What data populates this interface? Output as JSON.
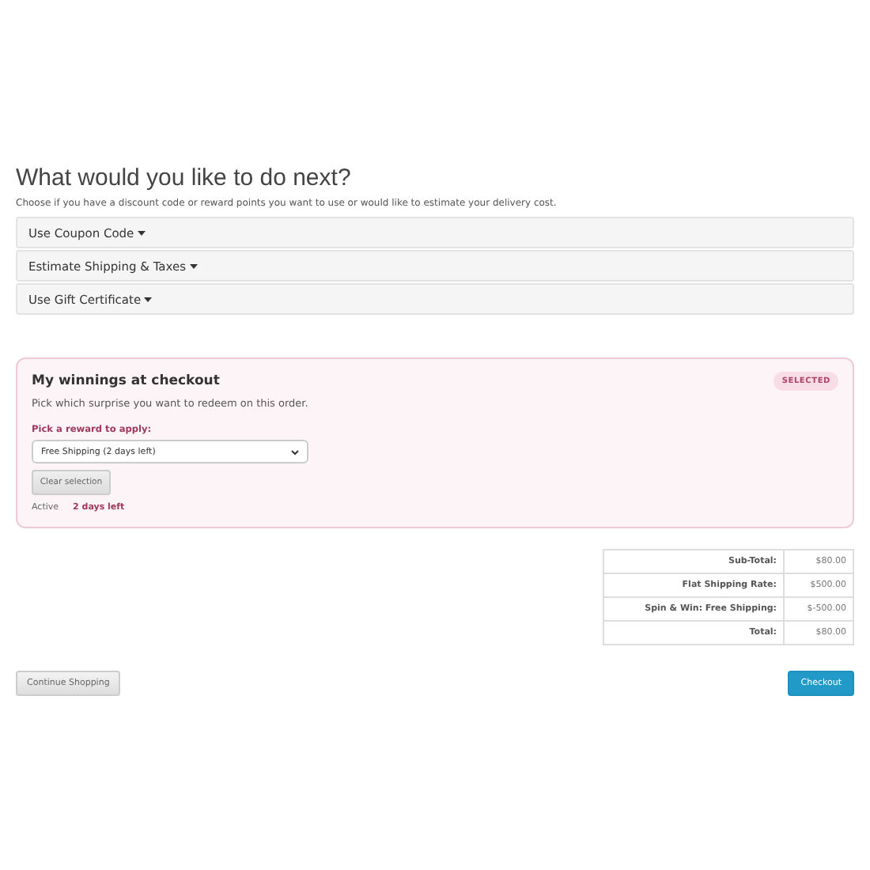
{
  "heading": "What would you like to do next?",
  "intro": "Choose if you have a discount code or reward points you want to use or would like to estimate your delivery cost.",
  "panels": [
    {
      "title": "Use Coupon Code",
      "expanded": false
    },
    {
      "title": "Estimate Shipping & Taxes",
      "expanded": false
    },
    {
      "title": "Use Gift Certificate",
      "expanded": false
    }
  ],
  "rewards": {
    "title": "My winnings at checkout",
    "badge": "SELECTED",
    "description": "Pick which surprise you want to redeem on this order.",
    "select_label": "Pick a reward to apply:",
    "select_value": "Free Shipping (2 days left)",
    "clear_button": "Clear selection",
    "status": "Active",
    "remaining": "2 days left"
  },
  "totals": [
    {
      "label": "Sub-Total:",
      "value": "$80.00"
    },
    {
      "label": "Flat Shipping Rate:",
      "value": "$500.00"
    },
    {
      "label": "Spin & Win: Free Shipping:",
      "value": "$-500.00"
    },
    {
      "label": "Total:",
      "value": "$80.00"
    }
  ],
  "buttons": {
    "continue": "Continue Shopping",
    "checkout": "Checkout"
  }
}
